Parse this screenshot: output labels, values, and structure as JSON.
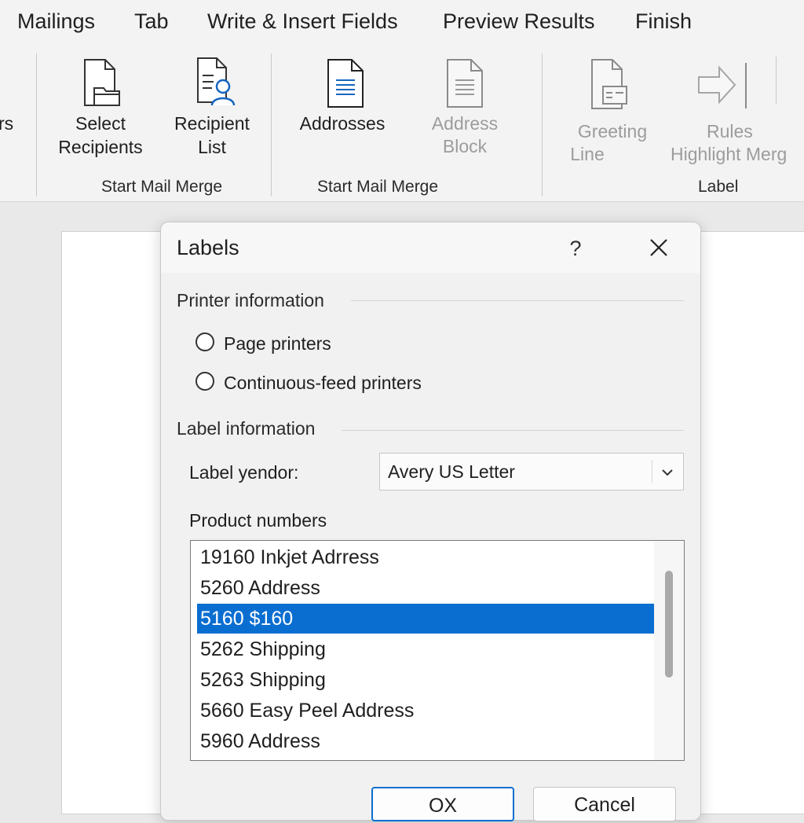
{
  "ribbon": {
    "tabs": [
      "Mailings",
      "Tab",
      "Write & Insert Fields",
      "Preview Results",
      "Finish"
    ],
    "partial_label": "rs",
    "buttons": {
      "select_recipients": [
        "Select",
        "Recipients"
      ],
      "recipient_list": [
        "Recipient",
        "List"
      ],
      "addresses": "Addrosses",
      "address_block": [
        "Address",
        "Block"
      ],
      "greeting_line": [
        "Greeting",
        "Line"
      ],
      "rules": [
        "Rules",
        "Highlight Merg"
      ]
    },
    "groups": {
      "g1": "Start Mail Merge",
      "g2": "Start Mail Merge",
      "g3": "Label"
    }
  },
  "dialog": {
    "title": "Labels",
    "help": "?",
    "printer_section": "Printer information",
    "printer_options": [
      "Page printers",
      "Continuous-feed printers"
    ],
    "label_section": "Label information",
    "vendor_label": "Label yendor:",
    "vendor_value": "Avery US Letter",
    "product_label": "Product numbers",
    "products": [
      "19160 Inkjet Adrress",
      "5260 Address",
      "5160 $160",
      "5262 Shipping",
      "5263 Shipping",
      "5660 Easy Peel Address",
      "5960 Address"
    ],
    "selected_product": "5160 $160",
    "ok": "OX",
    "cancel": "Cancel"
  }
}
